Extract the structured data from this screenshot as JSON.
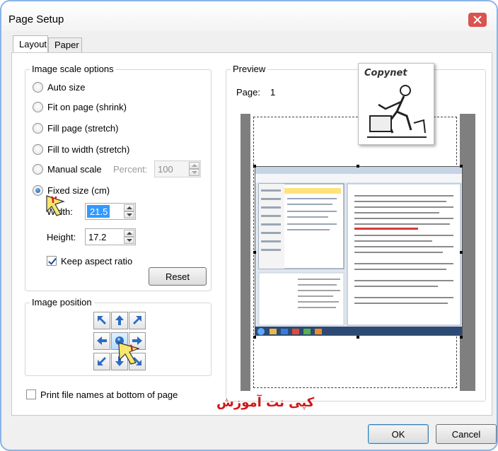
{
  "window": {
    "title": "Page Setup"
  },
  "tabs": [
    {
      "label": "Layout",
      "active": true
    },
    {
      "label": "Paper",
      "active": false
    }
  ],
  "scale": {
    "group_label": "Image scale options",
    "options": [
      {
        "label": "Auto size",
        "selected": false
      },
      {
        "label": "Fit on page (shrink)",
        "selected": false
      },
      {
        "label": "Fill page (stretch)",
        "selected": false
      },
      {
        "label": "Fill to width (stretch)",
        "selected": false
      },
      {
        "label": "Manual scale",
        "selected": false
      },
      {
        "label": "Fixed size (cm)",
        "selected": true
      }
    ],
    "percent_label": "Percent:",
    "percent_value": "100",
    "width_label": "Width:",
    "width_value": "21.5",
    "height_label": "Height:",
    "height_value": "17.2",
    "keep_aspect_label": "Keep aspect ratio",
    "keep_aspect_checked": true,
    "reset_label": "Reset"
  },
  "position": {
    "group_label": "Image position",
    "grid": [
      "arrow-up-left-icon",
      "arrow-up-icon",
      "arrow-up-right-icon",
      "arrow-left-icon",
      "center-icon",
      "arrow-right-icon",
      "arrow-down-left-icon",
      "arrow-down-icon",
      "arrow-down-right-icon"
    ]
  },
  "print_filenames_label": "Print file names at bottom of page",
  "print_filenames_checked": false,
  "preview": {
    "group_label": "Preview",
    "page_label": "Page:",
    "page_number": "1",
    "watermark_text": "Copynet"
  },
  "annotations": {
    "marker_1": "۱",
    "marker_2": "۲",
    "footer_text": "کپی نت آموزش"
  },
  "buttons": {
    "ok": "OK",
    "cancel": "Cancel"
  },
  "colors": {
    "accent": "#3399ff",
    "window_border": "#8ab4e8",
    "annotation_red": "#d21616",
    "annotation_yellow": "#f5e66e"
  }
}
